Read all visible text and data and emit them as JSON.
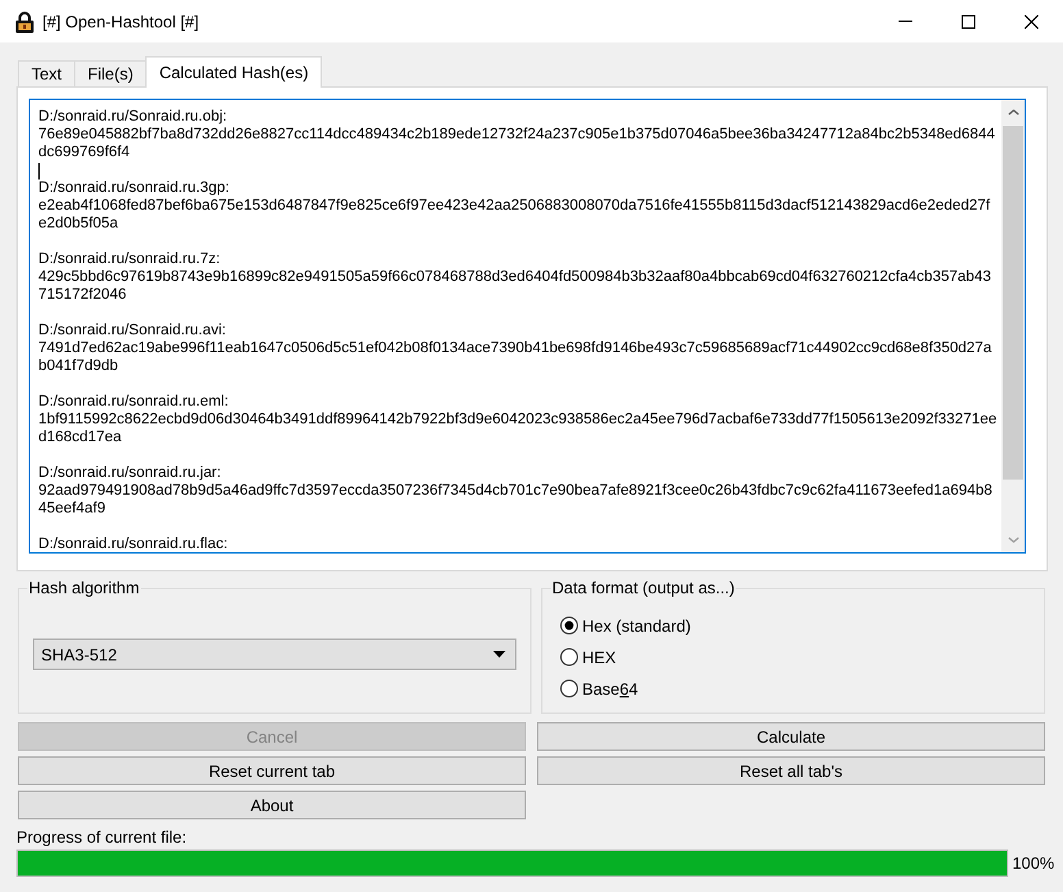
{
  "window": {
    "title": "[#] Open-Hashtool [#]"
  },
  "tabs": [
    {
      "label": "Text",
      "selected": false
    },
    {
      "label": "File(s)",
      "selected": false
    },
    {
      "label": "Calculated Hash(es)",
      "selected": true
    }
  ],
  "output": {
    "focused": true,
    "entries": [
      {
        "path": "D:/sonraid.ru/Sonraid.ru.obj:",
        "hash": "76e89e045882bf7ba8d732dd26e8827cc114dcc489434c2b189ede12732f24a237c905e1b375d07046a5bee36ba34247712a84bc2b5348ed6844dc699769f6f4",
        "caret_after": true
      },
      {
        "path": "D:/sonraid.ru/sonraid.ru.3gp:",
        "hash": "e2eab4f1068fed87bef6ba675e153d6487847f9e825ce6f97ee423e42aa2506883008070da7516fe41555b8115d3dacf512143829acd6e2eded27fe2d0b5f05a",
        "caret_after": false
      },
      {
        "path": "D:/sonraid.ru/sonraid.ru.7z:",
        "hash": "429c5bbd6c97619b8743e9b16899c82e9491505a59f66c078468788d3ed6404fd500984b3b32aaf80a4bbcab69cd04f632760212cfa4cb357ab43715172f2046",
        "caret_after": false
      },
      {
        "path": "D:/sonraid.ru/Sonraid.ru.avi:",
        "hash": "7491d7ed62ac19abe996f11eab1647c0506d5c51ef042b08f0134ace7390b41be698fd9146be493c7c59685689acf71c44902cc9cd68e8f350d27ab041f7d9db",
        "caret_after": false
      },
      {
        "path": "D:/sonraid.ru/sonraid.ru.eml:",
        "hash": "1bf9115992c8622ecbd9d06d30464b3491ddf89964142b7922bf3d9e6042023c938586ec2a45ee796d7acbaf6e733dd77f1505613e2092f33271eed168cd17ea",
        "caret_after": false
      },
      {
        "path": "D:/sonraid.ru/sonraid.ru.jar:",
        "hash": "92aad979491908ad78b9d5a46ad9ffc7d3597eccda3507236f7345d4cb701c7e90bea7afe8921f3cee0c26b43fdbc7c9c62fa411673eefed1a694b845eef4af9",
        "caret_after": false
      },
      {
        "path": "D:/sonraid.ru/sonraid.ru.flac:",
        "caret_after": false
      }
    ]
  },
  "hash_algorithm": {
    "title": "Hash algorithm",
    "value": "SHA3-512"
  },
  "data_format": {
    "title": "Data format (output as...)",
    "options": [
      {
        "label_parts": [
          {
            "text": "Hex (standard)",
            "underlined": false
          }
        ],
        "selected": true
      },
      {
        "label_parts": [
          {
            "text": "HEX",
            "underlined": false
          }
        ],
        "selected": false
      },
      {
        "label_parts": [
          {
            "text": "Base",
            "underlined": false
          },
          {
            "text": "6",
            "underlined": true
          },
          {
            "text": "4",
            "underlined": false
          }
        ],
        "selected": false
      }
    ]
  },
  "buttons": [
    {
      "label": "Cancel",
      "disabled": true
    },
    {
      "label": "Calculate",
      "disabled": false
    },
    {
      "label": "Reset current tab",
      "disabled": false
    },
    {
      "label": "Reset all tab's",
      "disabled": false
    },
    {
      "label": "About",
      "disabled": false
    }
  ],
  "progress": {
    "label": "Progress of current file:",
    "level": 1,
    "reading": "100%"
  }
}
